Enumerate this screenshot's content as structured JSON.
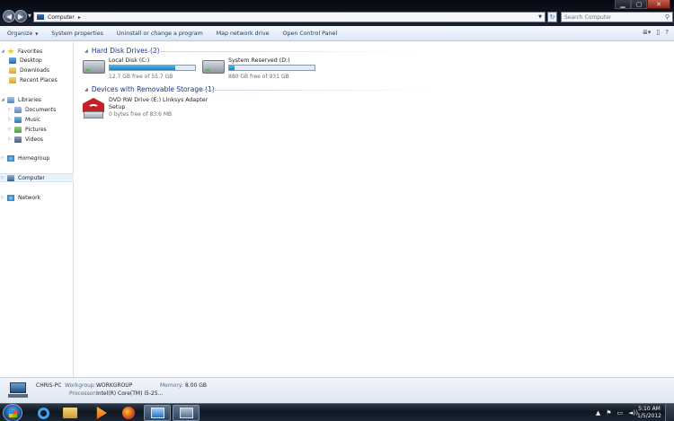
{
  "window": {
    "caption_min": "▁",
    "caption_max": "▢",
    "caption_close": "✕"
  },
  "address": {
    "path": "Computer",
    "separator": "▸",
    "search_placeholder": "Search Computer"
  },
  "toolbar": {
    "commands": [
      {
        "label": "Organize",
        "arrow": "▼"
      },
      {
        "label": "System properties"
      },
      {
        "label": "Uninstall or change a program"
      },
      {
        "label": "Map network drive"
      },
      {
        "label": "Open Control Panel"
      }
    ],
    "view_icon": "≣▾",
    "preview_icon": "▯",
    "help_icon": "?"
  },
  "nav": {
    "favorites": "Favorites",
    "desktop": "Desktop",
    "downloads": "Downloads",
    "recent": "Recent Places",
    "libraries": "Libraries",
    "documents": "Documents",
    "music": "Music",
    "pictures": "Pictures",
    "videos": "Videos",
    "homegroup": "Homegroup",
    "computer": "Computer",
    "network": "Network"
  },
  "content": {
    "hdd_group": "Hard Disk Drives (2)",
    "removable_group": "Devices with Removable Storage (1)",
    "drives": [
      {
        "name": "Local Disk (C:)",
        "free": "12.7 GB free of 55.7 GB",
        "used_fraction": 0.77
      },
      {
        "name": "System Reserved (D:)",
        "free": "880 GB free of 931 GB",
        "used_fraction": 0.06
      }
    ],
    "dvd": {
      "name_line1": "DVD RW Drive (E:) Linksys Adapter",
      "name_line2": "Setup",
      "free": "0 bytes free of 83.6 MB"
    }
  },
  "details": {
    "pc_name": "CHRIS-PC",
    "workgroup_label": "Workgroup:",
    "workgroup_value": "WORKGROUP",
    "memory_label": "Memory:",
    "memory_value": "8.00 GB",
    "processor_label": "Processor:",
    "processor_value": "Intel(R) Core(TM) i5-25..."
  },
  "taskbar": {
    "time": "5:10 AM",
    "date": "1/5/2012",
    "tray_icons": [
      "▲",
      "⚑",
      "▭",
      "◄))"
    ]
  },
  "colors": {
    "group_header": "#1e3287",
    "bar_fill": "#1781c6"
  }
}
